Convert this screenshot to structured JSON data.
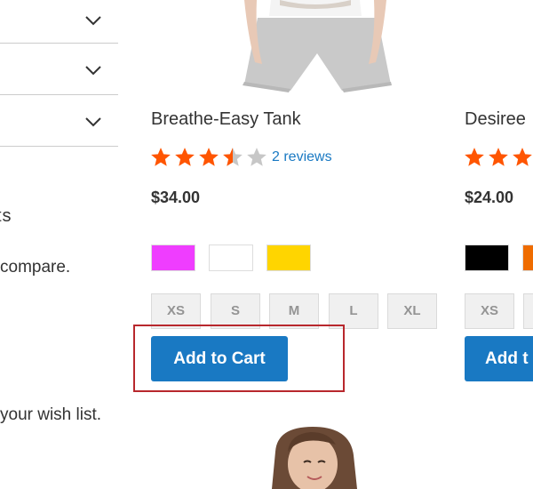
{
  "sidebar": {
    "compare_text_fragment": "ts",
    "compare_message": "compare.",
    "wishlist_message": "your wish list."
  },
  "products": [
    {
      "name": "Breathe-Easy Tank",
      "rating_fraction": 0.7,
      "reviews": "2 reviews",
      "price": "$34.00",
      "swatch_colors": [
        "#ef3dff",
        "#ffffff",
        "#ffd500"
      ],
      "sizes": [
        "XS",
        "S",
        "M",
        "L",
        "XL"
      ],
      "add_to_cart": "Add to Cart"
    },
    {
      "name": "Desiree",
      "price": "$24.00",
      "sizes": [
        "XS"
      ],
      "add_to_cart": "Add t"
    }
  ],
  "colors": {
    "accent": "#1979c3",
    "star": "#ff5501",
    "highlight": "#b8282d"
  }
}
